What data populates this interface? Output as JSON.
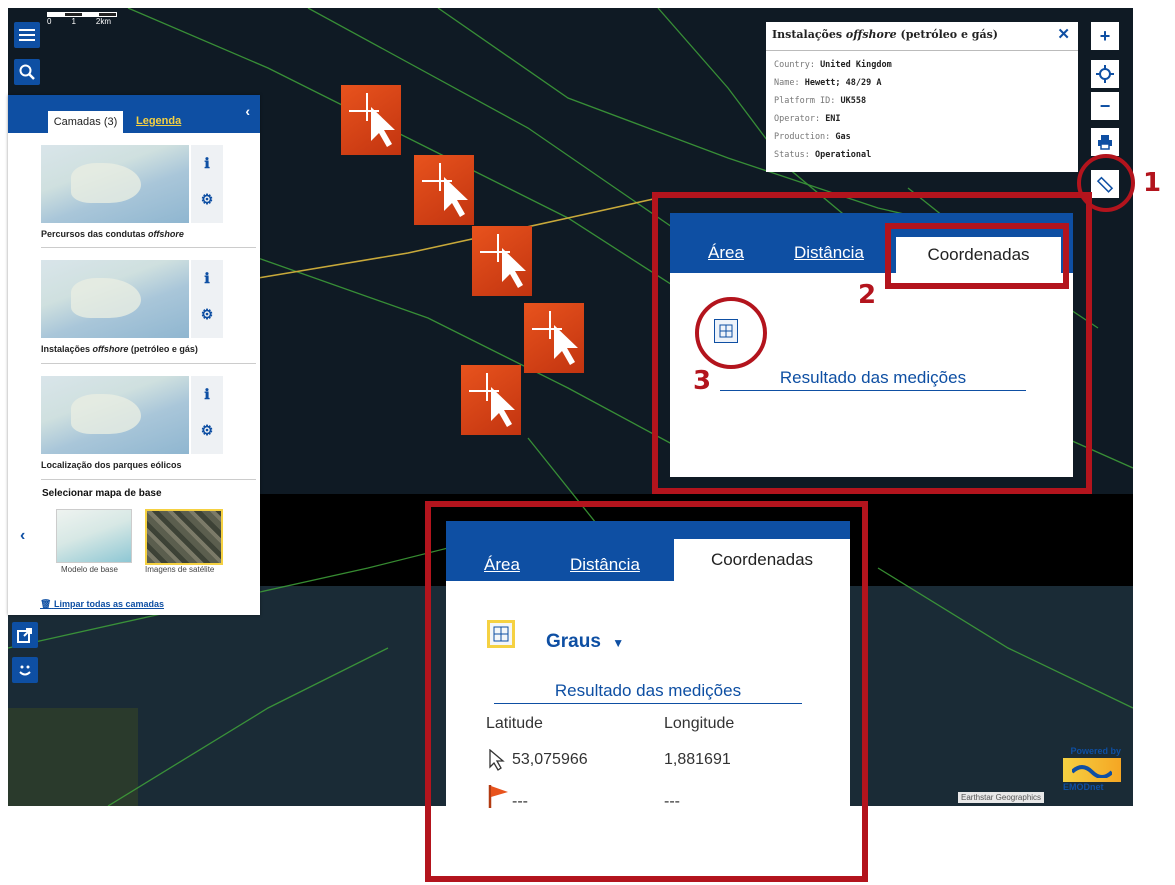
{
  "map": {
    "scale_ticks": [
      "0",
      "1",
      "2km"
    ],
    "attribution": "Earthstar Geographics",
    "powered_by": "Powered by",
    "logo": "EMODnet"
  },
  "layers_panel": {
    "tab_layers": "Camadas (3)",
    "tab_legend": "Legenda",
    "layers": [
      {
        "name": "Percursos das condutas ",
        "name_em": "offshore",
        "name_after": ""
      },
      {
        "name": "Instalações ",
        "name_em": "offshore",
        "name_after": " (petróleo e gás)"
      },
      {
        "name": "Localização dos parques eólicos",
        "name_em": "",
        "name_after": ""
      }
    ],
    "basemap_title": "Selecionar mapa de base",
    "basemaps": [
      "Modelo de base",
      "Imagens de satélite"
    ],
    "clear_all": "Limpar todas as camadas"
  },
  "info_popup": {
    "title_before": "Instalações ",
    "title_em": "offshore",
    "title_after": " (petróleo e gás)",
    "rows": [
      {
        "label": "Country: ",
        "value": "United Kingdom"
      },
      {
        "label": "Name: ",
        "value": "Hewett; 48/29 A"
      },
      {
        "label": "Platform ID: ",
        "value": "UK558"
      },
      {
        "label": "Operator: ",
        "value": "ENI"
      },
      {
        "label": "Production: ",
        "value": "Gas"
      },
      {
        "label": "Status: ",
        "value": "Operational"
      }
    ]
  },
  "measure_small": {
    "tabs": [
      "Área",
      "Distância",
      "Coordenadas"
    ],
    "result_title": "Resultado das medições"
  },
  "measure_large": {
    "tabs": [
      "Área",
      "Distância",
      "Coordenadas"
    ],
    "unit": "Graus",
    "result_title": "Resultado das medições",
    "col_lat": "Latitude",
    "col_lon": "Longitude",
    "pointer_lat": "53,075966",
    "pointer_lon": "1,881691",
    "flag_lat": "---",
    "flag_lon": "---"
  },
  "callouts": [
    "1",
    "2",
    "3"
  ],
  "colors": {
    "accent": "#0e4fa3",
    "highlight": "#b3141d",
    "marker": "#e8531d"
  }
}
